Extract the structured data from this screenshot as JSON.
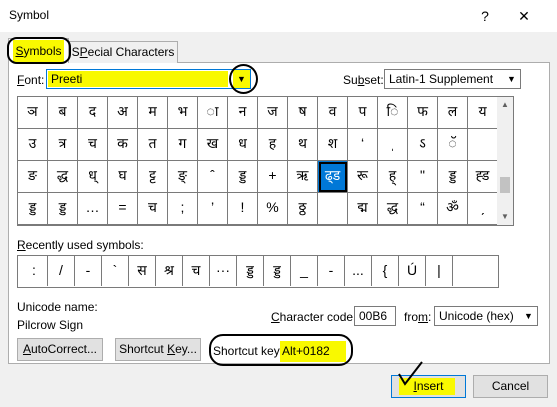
{
  "window": {
    "title": "Symbol",
    "help": "?",
    "close": "✕"
  },
  "tabs": [
    {
      "label": "Symbols",
      "accesskey": "S",
      "rest": "ymbols",
      "active": true
    },
    {
      "label": "Special Characters",
      "accesskey": "P",
      "pre": "S",
      "rest": "ecial Characters",
      "active": false
    }
  ],
  "font": {
    "label_pre": "",
    "accesskey": "F",
    "label_rest": "ont:",
    "value": "Preeti"
  },
  "subset": {
    "label_pre": "Su",
    "accesskey": "b",
    "label_rest": "set:",
    "value": "Latin-1 Supplement"
  },
  "symbol_grid": [
    [
      "ञ",
      "ब",
      "द",
      "अ",
      "म",
      "भ",
      "ा",
      "न",
      "ज",
      "ष",
      "व",
      "प",
      "ि",
      "फ",
      "ल",
      "य"
    ],
    [
      "उ",
      "त्र",
      "च",
      "क",
      "त",
      "ग",
      "ख",
      "ध",
      "ह",
      "थ",
      "श",
      "‘",
      "ˌ",
      "ऽ",
      "ॅ",
      ""
    ],
    [
      "ङ",
      "द्ध",
      "ध्",
      "घ",
      "ट्ट",
      "ङ्",
      "ˆ",
      "ड्ड",
      "+",
      "ऋ",
      "ढ्ड",
      "रू",
      "ह्",
      "\"",
      "ड्ड",
      "ह्ड"
    ],
    [
      "ड्ड",
      "ड्ड",
      "…",
      "=",
      "च",
      ";",
      "’",
      "!",
      "%",
      "ठ्ठ",
      "",
      "द्म",
      "द्ध",
      "“",
      "ॐ",
      "ˏ"
    ]
  ],
  "selected_cell": {
    "row": 2,
    "col": 10
  },
  "recent": {
    "label": "Recently used symbols:",
    "accesskey": "R",
    "items": [
      ":",
      "/",
      "-",
      "`",
      "स",
      "श्र",
      "च",
      "···",
      "ड्ड",
      "ड्ड",
      "_",
      "-",
      "...",
      "{",
      "Ú",
      "|"
    ]
  },
  "unicode_name": {
    "label": "Unicode name:",
    "value": "Pilcrow Sign"
  },
  "character_code": {
    "label_pre": "",
    "accesskey": "C",
    "label_rest": "haracter code:",
    "value": "00B6"
  },
  "from": {
    "label_pre": "fro",
    "accesskey": "m",
    "label_rest": ":",
    "value": "Unicode (hex)"
  },
  "buttons": {
    "autocorrect": {
      "pre": "",
      "accesskey": "A",
      "rest": "utoCorrect..."
    },
    "shortcut": {
      "pre": "Shortcut ",
      "accesskey": "K",
      "rest": "ey..."
    },
    "insert": {
      "pre": "",
      "accesskey": "I",
      "rest": "nsert"
    },
    "cancel": {
      "label": "Cancel"
    }
  },
  "shortcut_key": {
    "label": "Shortcut key:",
    "value": "Alt+0182"
  },
  "colors": {
    "highlight": "#f9f900",
    "selection": "#0078d7",
    "accent": "#0078d7"
  }
}
